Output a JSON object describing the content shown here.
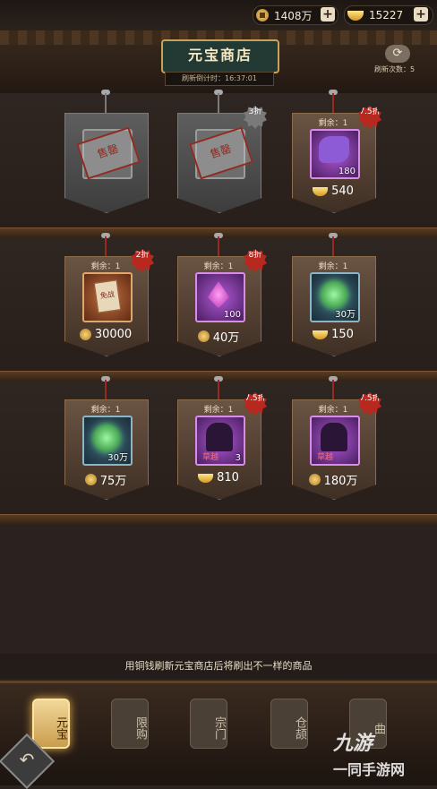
{
  "resources": {
    "copper": {
      "value": "1408万",
      "icon": "copper-coin-icon"
    },
    "ingot": {
      "value": "15227",
      "icon": "gold-ingot-icon"
    }
  },
  "header": {
    "title": "元宝商店",
    "timer_label": "刷新倒计时：",
    "timer_value": "16:37:01",
    "refresh_label": "刷新次数：",
    "refresh_count": "5"
  },
  "shelves": [
    [
      {
        "remain": "",
        "sold": true,
        "stamp": "售罄",
        "qty": "",
        "price": "",
        "discount": "",
        "currency": ""
      },
      {
        "remain": "",
        "sold": true,
        "stamp": "售罄",
        "qty": "",
        "price": "",
        "discount": "3折",
        "currency": ""
      },
      {
        "remain": "剩余：1",
        "sold": false,
        "item": "puzzle",
        "qty": "180",
        "price": "540",
        "discount": "7.5折",
        "currency": "ingot"
      }
    ],
    [
      {
        "remain": "剩余：1",
        "sold": false,
        "item": "document",
        "qty": "",
        "label": "免战",
        "price": "30000",
        "discount": "2折",
        "currency": "copper"
      },
      {
        "remain": "剩余：1",
        "sold": false,
        "item": "gem",
        "qty": "100",
        "price": "40万",
        "discount": "8折",
        "currency": "copper"
      },
      {
        "remain": "剩余：1",
        "sold": false,
        "item": "orb",
        "qty": "30万",
        "price": "150",
        "discount": "",
        "currency": "ingot"
      }
    ],
    [
      {
        "remain": "剩余：1",
        "sold": false,
        "item": "orb",
        "qty": "30万",
        "price": "75万",
        "discount": "",
        "currency": "copper"
      },
      {
        "remain": "剩余：1",
        "sold": false,
        "item": "silhouette",
        "qty": "3",
        "label": "草越",
        "price": "810",
        "discount": "7.5折",
        "currency": "ingot"
      },
      {
        "remain": "剩余：1",
        "sold": false,
        "item": "silhouette",
        "qty": "",
        "label": "草越",
        "price": "180万",
        "discount": "7.5折",
        "currency": "copper"
      }
    ]
  ],
  "notice": "用铜钱刷新元宝商店后将刷出不一样的商品",
  "tabs": [
    {
      "label": "元宝",
      "active": true
    },
    {
      "label": "限购",
      "active": false
    },
    {
      "label": "宗门",
      "active": false
    },
    {
      "label": "仓颉",
      "active": false
    },
    {
      "label": "曲",
      "active": false
    }
  ],
  "watermark": {
    "main": "九游",
    "sub": "一同手游网"
  }
}
